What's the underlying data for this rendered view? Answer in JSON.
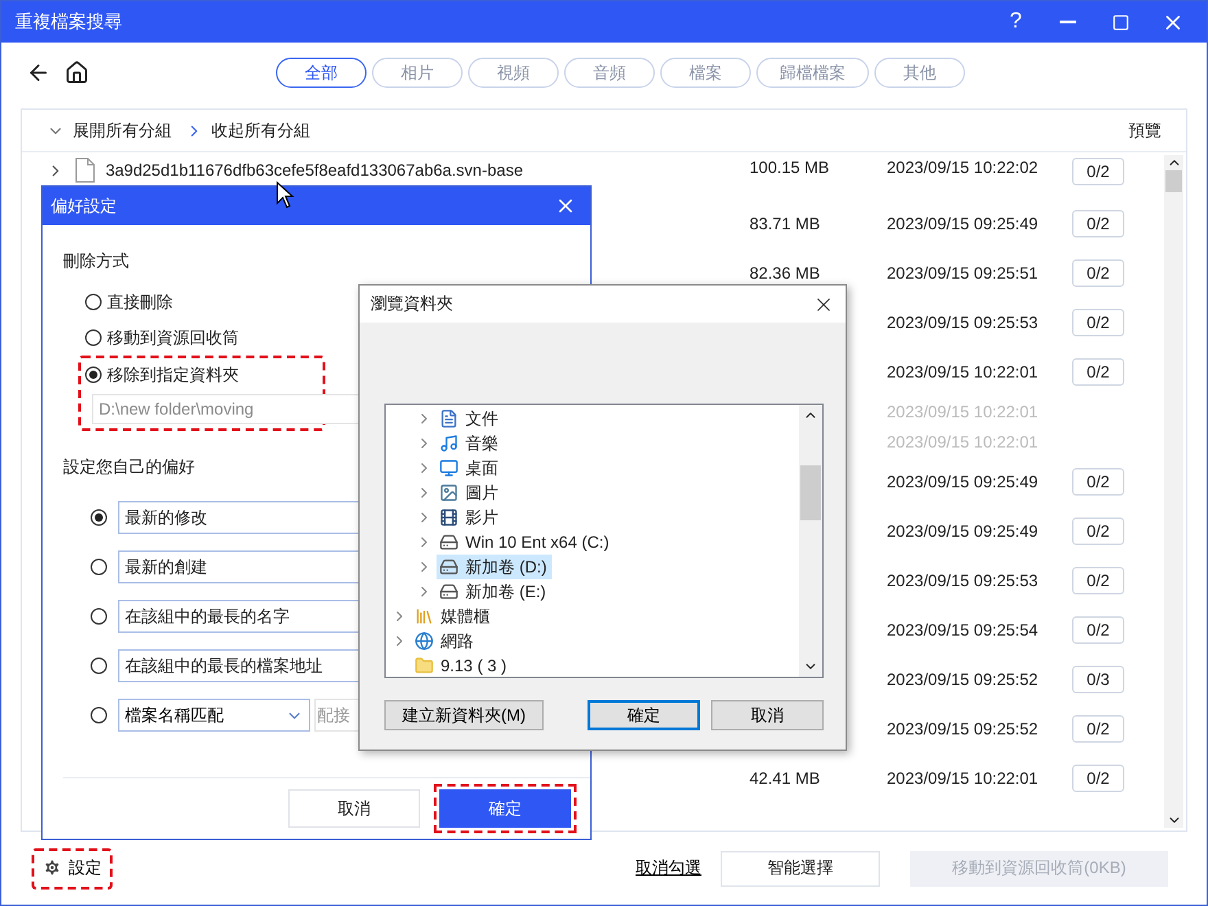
{
  "window": {
    "title": "重複檔案搜尋",
    "help": "?"
  },
  "tabs": [
    {
      "label": "全部",
      "selected": true
    },
    {
      "label": "相片",
      "selected": false
    },
    {
      "label": "視頻",
      "selected": false
    },
    {
      "label": "音頻",
      "selected": false
    },
    {
      "label": "檔案",
      "selected": false
    },
    {
      "label": "歸檔檔案",
      "selected": false
    },
    {
      "label": "其他",
      "selected": false
    }
  ],
  "group_bar": {
    "expand_all": "展開所有分組",
    "collapse_all": "收起所有分組",
    "preview": "預覽"
  },
  "rows": [
    {
      "name": "3a9d25d1b11676dfb63cefe5f8eafd133067ab6a.svn-base",
      "size": "100.15 MB",
      "date": "2023/09/15 10:22:02",
      "count": "0/2",
      "dimmed": false
    },
    {
      "size": "83.71 MB",
      "date": "2023/09/15 09:25:49",
      "count": "0/2",
      "dimmed": false
    },
    {
      "size": "82.36 MB",
      "date": "2023/09/15 09:25:51",
      "count": "0/2",
      "dimmed": false
    },
    {
      "date": "2023/09/15 09:25:53",
      "count": "0/2",
      "dimmed": false
    },
    {
      "date": "2023/09/15 10:22:01",
      "count": "0/2",
      "dimmed": false
    },
    {
      "date": "2023/09/15 10:22:01",
      "dimmed": true
    },
    {
      "date": "2023/09/15 10:22:01",
      "dimmed": true
    },
    {
      "date": "2023/09/15 09:25:49",
      "count": "0/2",
      "dimmed": false
    },
    {
      "date": "2023/09/15 09:25:49",
      "count": "0/2",
      "dimmed": false
    },
    {
      "date": "2023/09/15 09:25:53",
      "count": "0/2",
      "dimmed": false
    },
    {
      "date": "2023/09/15 09:25:54",
      "count": "0/2",
      "dimmed": false
    },
    {
      "date": "2023/09/15 09:25:52",
      "count": "0/3",
      "dimmed": false
    },
    {
      "date": "2023/09/15 09:25:52",
      "count": "0/2",
      "dimmed": false
    },
    {
      "size": "42.41 MB",
      "date": "2023/09/15 10:22:01",
      "count": "0/2",
      "dimmed": false
    }
  ],
  "footer": {
    "settings": "設定",
    "settings_highlighted": true,
    "uncheck": "取消勾選",
    "smart_select": "智能選擇",
    "move_button": {
      "label": "移動到資源回收筒(0KB)",
      "disabled": true
    }
  },
  "preferences_dialog": {
    "title": "偏好設定",
    "delete_section": "刪除方式",
    "delete_options": [
      {
        "label": "直接刪除",
        "selected": false,
        "highlighted": false
      },
      {
        "label": "移動到資源回收筒",
        "selected": false,
        "highlighted": false
      },
      {
        "label": "移除到指定資料夾",
        "selected": true,
        "highlighted": true,
        "path": "D:\\new folder\\moving"
      }
    ],
    "preference_section": "設定您自己的偏好",
    "preference_options": [
      {
        "kind": "field",
        "value": "最新的修改",
        "selected": true
      },
      {
        "kind": "field",
        "value": "最新的創建",
        "selected": false
      },
      {
        "kind": "field",
        "value": "在該組中的最長的名字",
        "selected": false
      },
      {
        "kind": "field",
        "value": "在該組中的最長的檔案地址",
        "selected": false
      },
      {
        "kind": "dropdown",
        "value": "檔案名稱匹配",
        "extra": "配接",
        "selected": false
      }
    ],
    "buttons": [
      {
        "label": "取消",
        "primary": false,
        "highlighted": false
      },
      {
        "label": "確定",
        "primary": true,
        "highlighted": true
      }
    ]
  },
  "browse_dialog": {
    "title": "瀏覽資料夾",
    "tree": [
      {
        "children": [
          {
            "label": "文件",
            "kind": "document",
            "expandable": true,
            "selected": false
          },
          {
            "label": "音樂",
            "kind": "music",
            "expandable": true,
            "selected": false
          },
          {
            "label": "桌面",
            "kind": "desktop",
            "expandable": true,
            "selected": false
          },
          {
            "label": "圖片",
            "kind": "pictures",
            "expandable": true,
            "selected": false
          },
          {
            "label": "影片",
            "kind": "videos",
            "expandable": true,
            "selected": false
          },
          {
            "label": "Win 10 Ent x64 (C:)",
            "kind": "system-drive",
            "expandable": true,
            "selected": false
          },
          {
            "label": "新加卷 (D:)",
            "kind": "drive",
            "expandable": true,
            "selected": true
          },
          {
            "label": "新加卷 (E:)",
            "kind": "drive",
            "expandable": true,
            "selected": false
          }
        ]
      },
      {
        "label": "媒體櫃",
        "kind": "library",
        "expandable": true,
        "selected": false
      },
      {
        "label": "網路",
        "kind": "network",
        "expandable": true,
        "selected": false
      },
      {
        "label": "9.13 ( 3 )",
        "kind": "folder",
        "expandable": false,
        "selected": false
      }
    ],
    "buttons": [
      {
        "label": "建立新資料夾(M)",
        "default": false
      },
      {
        "label": "確定",
        "default": true
      },
      {
        "label": "取消",
        "default": false
      }
    ]
  }
}
